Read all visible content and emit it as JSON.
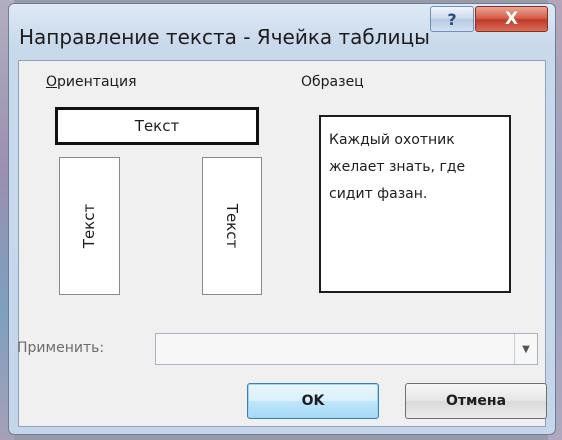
{
  "window": {
    "title": "Направление текста - Ячейка таблицы",
    "help_label": "?",
    "close_label": "X"
  },
  "orientation": {
    "label_accel": "О",
    "label_rest": "риентация",
    "options": [
      "Текст",
      "Текст",
      "Текст"
    ]
  },
  "sample": {
    "label": "Образец",
    "text": "Каждый охотник желает знать, где сидит фазан."
  },
  "apply": {
    "label": "Применить:",
    "value": "",
    "arrow_icon": "dropdown-arrow-icon"
  },
  "buttons": {
    "ok": "OK",
    "cancel": "Отмена"
  }
}
